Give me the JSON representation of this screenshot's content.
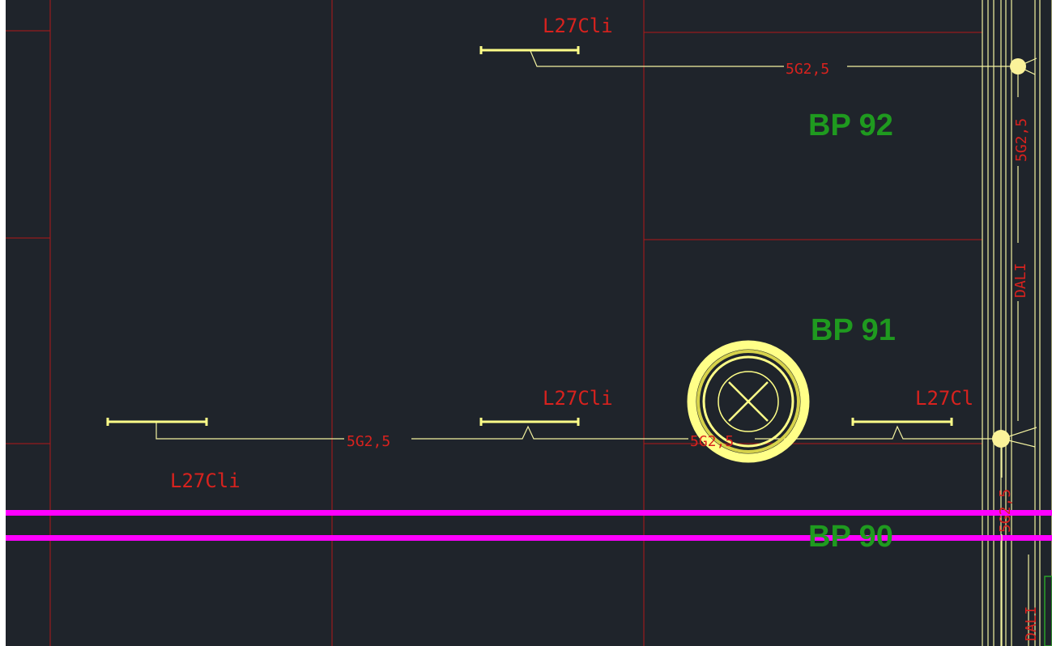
{
  "drawing": {
    "colors": {
      "background": "#1f242b",
      "grid_lines": "#b01818",
      "wiring": "#f3f2a0",
      "fixtures": "#ffff88",
      "text_red": "#d8221e",
      "text_green": "#1f9a1f",
      "magenta": "#ff00ff",
      "junction": "#fbf29a",
      "border_white": "#ffffff",
      "green_box": "#2aa12a"
    },
    "room_labels": [
      "BP 92",
      "BP 91",
      "BP 90"
    ],
    "fixture_labels": [
      "L27Cli",
      "L27Cli",
      "L27Cli",
      "L27Cl"
    ],
    "cable_labels": [
      "5G2,5",
      "5G2,5",
      "5G2,5",
      "5G2,5",
      "5G2,5"
    ],
    "bus_labels": [
      "DALI",
      "DALI"
    ],
    "icons": {
      "luminaire": "linear-luminaire-icon",
      "emergency": "crossed-circle-icon",
      "junction": "junction-dot-icon"
    }
  }
}
